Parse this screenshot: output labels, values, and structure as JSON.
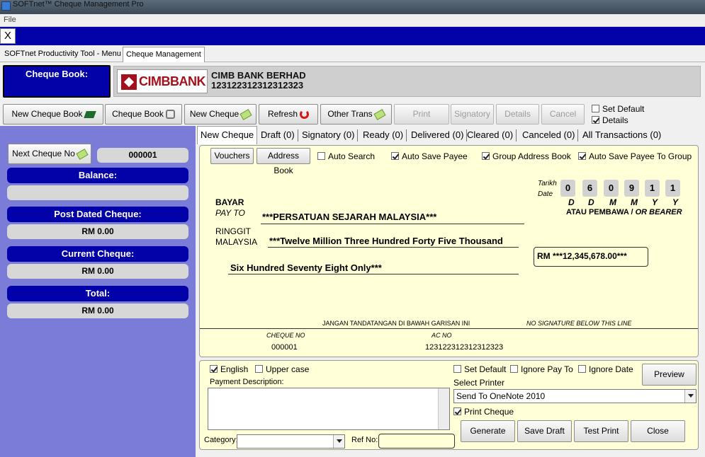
{
  "window": {
    "title": "SOFTnet™ Cheque Management Pro"
  },
  "menu": {
    "file": "File"
  },
  "close_label": "X",
  "tabs": [
    {
      "label": "SOFTnet Productivity Tool - Menu"
    },
    {
      "label": "Cheque Management"
    }
  ],
  "cheque_book": {
    "label": "Cheque Book:",
    "bank_logo_text": "CIMBBANK",
    "bank_name": "CIMB BANK BERHAD",
    "account_no": "123122312312312323"
  },
  "toolbar": {
    "new_cheque_book": "New Cheque Book",
    "cheque_book": "Cheque Book",
    "new_cheque": "New Cheque",
    "refresh": "Refresh",
    "other_trans": "Other Trans",
    "print": "Print",
    "signatory": "Signatory",
    "details": "Details",
    "cancel": "Cancel",
    "set_default": "Set Default",
    "details_check": "Details"
  },
  "left_panel": {
    "next_cheque_label": "Next Cheque No",
    "next_cheque_value": "000001",
    "balance_label": "Balance:",
    "balance_value": "",
    "post_dated_label": "Post Dated Cheque:",
    "post_dated_value": "RM 0.00",
    "current_label": "Current Cheque:",
    "current_value": "RM 0.00",
    "total_label": "Total:",
    "total_value": "RM 0.00"
  },
  "status_tabs": [
    {
      "label": "New Cheque"
    },
    {
      "label": "Draft (0)"
    },
    {
      "label": "Signatory (0)"
    },
    {
      "label": "Ready (0)"
    },
    {
      "label": "Delivered (0)"
    },
    {
      "label": "Cleared (0)"
    },
    {
      "label": "Canceled (0)"
    },
    {
      "label": "All Transactions (0)"
    }
  ],
  "cheque_form": {
    "vouchers": "Vouchers",
    "address_book": "Address Book",
    "auto_search": "Auto Search",
    "auto_save_payee": "Auto Save Payee",
    "group_address_book": "Group Address Book",
    "auto_save_payee_group": "Auto Save Payee To Group",
    "tarikh": "Tarikh",
    "date": "Date",
    "date_digits": [
      "0",
      "6",
      "0",
      "9",
      "1",
      "1"
    ],
    "date_format": [
      "D",
      "D",
      "M",
      "M",
      "Y",
      "Y"
    ],
    "bearer": "ATAU PEMBAWA / ",
    "bearer_en": "OR BEARER",
    "bayar": "BAYAR",
    "pay_to": "PAY TO",
    "payee": "***PERSATUAN SEJARAH MALAYSIA***",
    "ringgit": "RINGGIT",
    "malaysia": "MALAYSIA",
    "amount_words_1": "***Twelve Million Three Hundred Forty Five Thousand",
    "amount_words_2": "Six Hundred Seventy Eight Only***",
    "amount": "RM ***12,345,678.00***",
    "sign_note_ms": "JANGAN TANDATANGAN DI BAWAH GARISAN INI",
    "sign_note_en": "NO SIGNATURE BELOW THIS LINE",
    "cheque_no_label": "CHEQUE NO",
    "cheque_no": "000001",
    "ac_no_label": "AC NO",
    "ac_no": "123122312312312323"
  },
  "options": {
    "english": "English",
    "upper_case": "Upper case",
    "set_default": "Set Default",
    "ignore_pay_to": "Ignore Pay To",
    "ignore_date": "Ignore Date",
    "preview": "Preview",
    "payment_description": "Payment Description:",
    "select_printer": "Select Printer",
    "printer_value": "Send To OneNote 2010",
    "print_cheque": "Print Cheque",
    "category": "Category:",
    "category_value": "",
    "ref_no": "Ref No:",
    "ref_no_value": "",
    "generate": "Generate",
    "save_draft": "Save Draft",
    "test_print": "Test Print",
    "close": "Close"
  },
  "colors": {
    "navy": "#0202a8",
    "panel": "#7b7bd8",
    "cheque_bg": "#ffffd8",
    "bank_red": "#a4101c"
  }
}
